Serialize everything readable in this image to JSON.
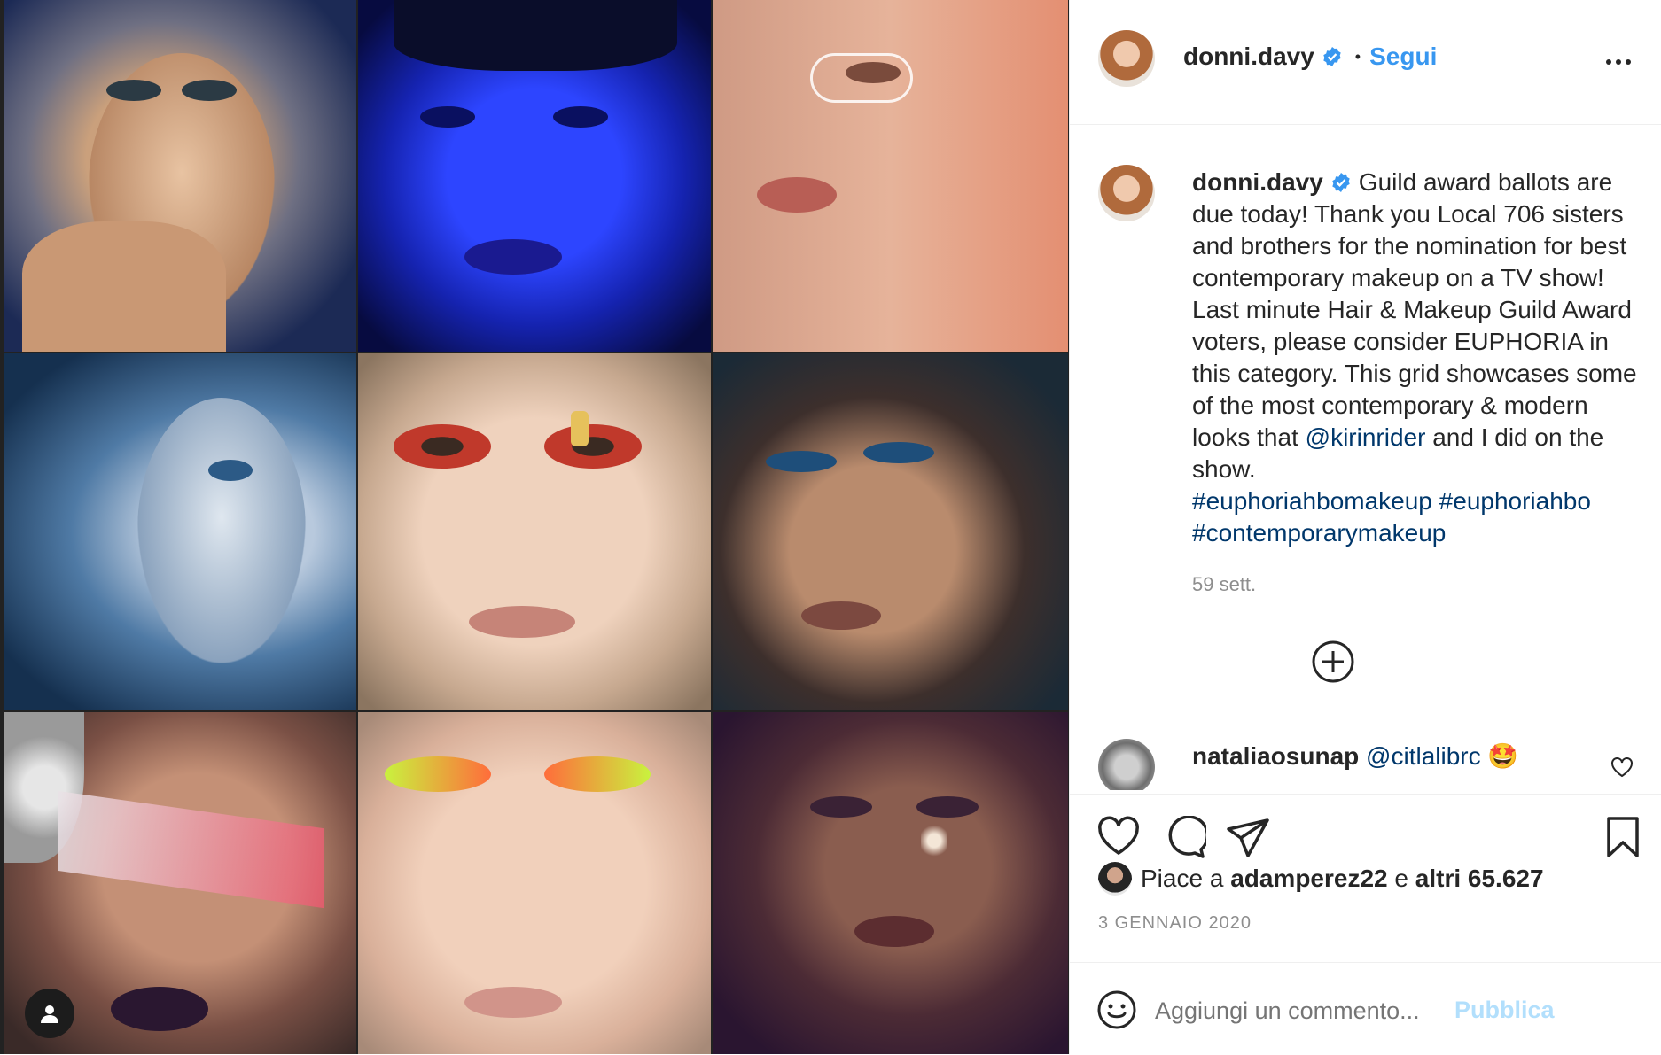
{
  "post": {
    "username": "donni.davy",
    "separator": "•",
    "follow_label": "Segui",
    "caption_main": "Guild award ballots are due today! Thank you Local 706 sisters and brothers for the nomination for best contemporary makeup on a TV show! Last minute Hair & Makeup Guild Award voters, please consider EUPHORIA in this category. This grid showcases some of the most contemporary & modern looks that",
    "mention_1": "@kirinrider",
    "caption_tail": " and I did on the show.",
    "hashtag_1": "#euphoriahbomakeup",
    "hashtag_2": "#euphoriahbo",
    "hashtag_3": "#contemporarymakeup",
    "caption_time": "59 sett.",
    "date": "3 GENNAIO 2020"
  },
  "comment": {
    "username": "nataliaosunap",
    "mention": "@citlalibrc",
    "emoji": "🤩"
  },
  "likes": {
    "prefix": "Piace a",
    "user": "adamperez22",
    "joiner": "e",
    "others": "altri 65.627"
  },
  "composer": {
    "placeholder": "Aggiungi un commento...",
    "publish_label": "Pubblica"
  },
  "colors": {
    "link": "#00376b",
    "follow": "#0095f6",
    "verified": "#3897f0",
    "muted": "#8e8e8e",
    "publish_disabled": "#b2dffc"
  },
  "icons": [
    "verified-badge-icon",
    "more-options-icon",
    "load-more-plus-icon",
    "heart-icon",
    "comment-icon",
    "share-icon",
    "bookmark-icon",
    "emoji-icon",
    "user-tag-icon",
    "comment-like-icon"
  ]
}
